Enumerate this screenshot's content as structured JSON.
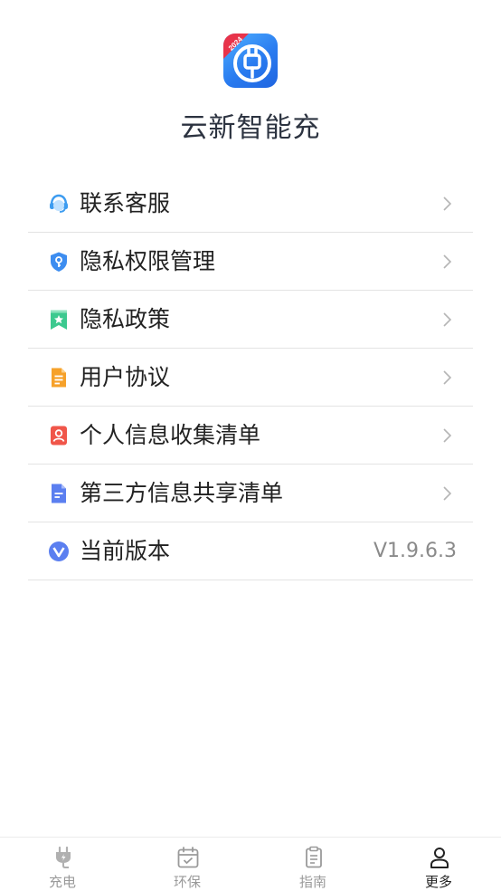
{
  "app": {
    "name": "云新智能充",
    "logo_badge": "2024"
  },
  "menu": {
    "items": [
      {
        "label": "联系客服",
        "icon": "headset-icon"
      },
      {
        "label": "隐私权限管理",
        "icon": "shield-key-icon"
      },
      {
        "label": "隐私政策",
        "icon": "bookmark-star-icon"
      },
      {
        "label": "用户协议",
        "icon": "document-icon"
      },
      {
        "label": "个人信息收集清单",
        "icon": "person-card-icon"
      },
      {
        "label": "第三方信息共享清单",
        "icon": "file-list-icon"
      }
    ],
    "version": {
      "label": "当前版本",
      "value": "V1.9.6.3",
      "icon": "version-v-icon"
    }
  },
  "tabbar": {
    "tabs": [
      {
        "label": "充电",
        "icon": "charging-plug-icon",
        "active": false
      },
      {
        "label": "环保",
        "icon": "calendar-check-icon",
        "active": false
      },
      {
        "label": "指南",
        "icon": "clipboard-icon",
        "active": false
      },
      {
        "label": "更多",
        "icon": "person-icon",
        "active": true
      }
    ]
  },
  "colors": {
    "accent_blue": "#2a7cf0",
    "badge_red": "#e8334a",
    "text_primary": "#222222",
    "text_secondary": "#8a8a8a",
    "divider": "#e3e3e3"
  }
}
